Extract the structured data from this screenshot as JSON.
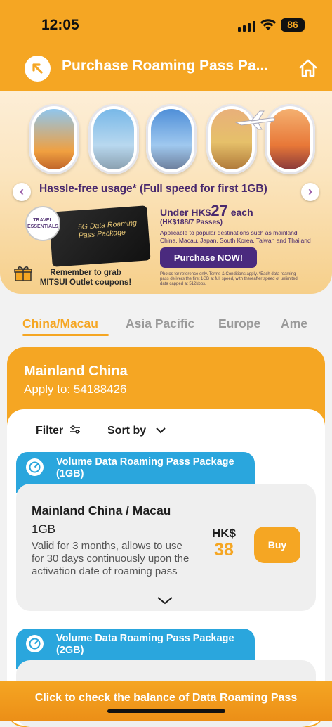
{
  "status": {
    "time": "12:05",
    "battery": "86"
  },
  "header": {
    "title": "Purchase Roaming Pass Pa..."
  },
  "banner": {
    "headline": "Hassle-free usage* (Full speed for first 1GB)",
    "card_text": "5G Data Roaming Pass Package",
    "badge": "TRAVEL ESSENTIALS",
    "under_prefix": "Under HK$",
    "under_price": "27",
    "under_suffix": "each",
    "under_sub": "(HK$188/7 Passes)",
    "applicable": "Applicable to popular destinations such as mainland China, Macau, Japan, South Korea, Taiwan and Thailand",
    "cta": "Purchase NOW!",
    "reminder": "Remember to grab MITSUI Outlet coupons!",
    "fine_print": "Photos for reference only. Terms & Conditions apply. *Each data roaming pass delivers the first 1GB at full speed, with thereafter speed of unlimited data capped at 512kbps."
  },
  "tabs": [
    {
      "label": "China/Macau",
      "active": true
    },
    {
      "label": "Asia Pacific"
    },
    {
      "label": "Europe"
    },
    {
      "label": "Ame"
    }
  ],
  "region": {
    "name": "Mainland China",
    "apply_to": "Apply to: 54188426"
  },
  "controls": {
    "filter": "Filter",
    "sort": "Sort by"
  },
  "packages": [
    {
      "tag": "Volume Data Roaming Pass Package (1GB)",
      "name": "Mainland China / Macau",
      "size": "1GB",
      "desc": "Valid for 3 months, allows to use for 30 days continuously upon the activation date of roaming pass",
      "currency": "HK$",
      "price": "38",
      "buy": "Buy"
    },
    {
      "tag": "Volume Data Roaming Pass Package (2GB)"
    }
  ],
  "footer": {
    "label": "Click to check the balance of Data Roaming Pass"
  },
  "colors": {
    "brand": "#f5a623",
    "tag": "#2aa6dd",
    "banner_text": "#4a2a6e"
  }
}
